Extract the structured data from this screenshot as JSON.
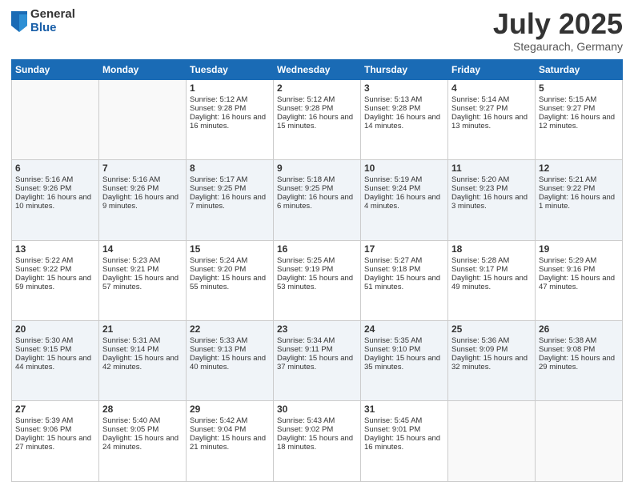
{
  "logo": {
    "general": "General",
    "blue": "Blue"
  },
  "title": {
    "month": "July 2025",
    "location": "Stegaurach, Germany"
  },
  "weekdays": [
    "Sunday",
    "Monday",
    "Tuesday",
    "Wednesday",
    "Thursday",
    "Friday",
    "Saturday"
  ],
  "weeks": [
    [
      {
        "num": "",
        "text": ""
      },
      {
        "num": "",
        "text": ""
      },
      {
        "num": "1",
        "text": "Sunrise: 5:12 AM\nSunset: 9:28 PM\nDaylight: 16 hours and 16 minutes."
      },
      {
        "num": "2",
        "text": "Sunrise: 5:12 AM\nSunset: 9:28 PM\nDaylight: 16 hours and 15 minutes."
      },
      {
        "num": "3",
        "text": "Sunrise: 5:13 AM\nSunset: 9:28 PM\nDaylight: 16 hours and 14 minutes."
      },
      {
        "num": "4",
        "text": "Sunrise: 5:14 AM\nSunset: 9:27 PM\nDaylight: 16 hours and 13 minutes."
      },
      {
        "num": "5",
        "text": "Sunrise: 5:15 AM\nSunset: 9:27 PM\nDaylight: 16 hours and 12 minutes."
      }
    ],
    [
      {
        "num": "6",
        "text": "Sunrise: 5:16 AM\nSunset: 9:26 PM\nDaylight: 16 hours and 10 minutes."
      },
      {
        "num": "7",
        "text": "Sunrise: 5:16 AM\nSunset: 9:26 PM\nDaylight: 16 hours and 9 minutes."
      },
      {
        "num": "8",
        "text": "Sunrise: 5:17 AM\nSunset: 9:25 PM\nDaylight: 16 hours and 7 minutes."
      },
      {
        "num": "9",
        "text": "Sunrise: 5:18 AM\nSunset: 9:25 PM\nDaylight: 16 hours and 6 minutes."
      },
      {
        "num": "10",
        "text": "Sunrise: 5:19 AM\nSunset: 9:24 PM\nDaylight: 16 hours and 4 minutes."
      },
      {
        "num": "11",
        "text": "Sunrise: 5:20 AM\nSunset: 9:23 PM\nDaylight: 16 hours and 3 minutes."
      },
      {
        "num": "12",
        "text": "Sunrise: 5:21 AM\nSunset: 9:22 PM\nDaylight: 16 hours and 1 minute."
      }
    ],
    [
      {
        "num": "13",
        "text": "Sunrise: 5:22 AM\nSunset: 9:22 PM\nDaylight: 15 hours and 59 minutes."
      },
      {
        "num": "14",
        "text": "Sunrise: 5:23 AM\nSunset: 9:21 PM\nDaylight: 15 hours and 57 minutes."
      },
      {
        "num": "15",
        "text": "Sunrise: 5:24 AM\nSunset: 9:20 PM\nDaylight: 15 hours and 55 minutes."
      },
      {
        "num": "16",
        "text": "Sunrise: 5:25 AM\nSunset: 9:19 PM\nDaylight: 15 hours and 53 minutes."
      },
      {
        "num": "17",
        "text": "Sunrise: 5:27 AM\nSunset: 9:18 PM\nDaylight: 15 hours and 51 minutes."
      },
      {
        "num": "18",
        "text": "Sunrise: 5:28 AM\nSunset: 9:17 PM\nDaylight: 15 hours and 49 minutes."
      },
      {
        "num": "19",
        "text": "Sunrise: 5:29 AM\nSunset: 9:16 PM\nDaylight: 15 hours and 47 minutes."
      }
    ],
    [
      {
        "num": "20",
        "text": "Sunrise: 5:30 AM\nSunset: 9:15 PM\nDaylight: 15 hours and 44 minutes."
      },
      {
        "num": "21",
        "text": "Sunrise: 5:31 AM\nSunset: 9:14 PM\nDaylight: 15 hours and 42 minutes."
      },
      {
        "num": "22",
        "text": "Sunrise: 5:33 AM\nSunset: 9:13 PM\nDaylight: 15 hours and 40 minutes."
      },
      {
        "num": "23",
        "text": "Sunrise: 5:34 AM\nSunset: 9:11 PM\nDaylight: 15 hours and 37 minutes."
      },
      {
        "num": "24",
        "text": "Sunrise: 5:35 AM\nSunset: 9:10 PM\nDaylight: 15 hours and 35 minutes."
      },
      {
        "num": "25",
        "text": "Sunrise: 5:36 AM\nSunset: 9:09 PM\nDaylight: 15 hours and 32 minutes."
      },
      {
        "num": "26",
        "text": "Sunrise: 5:38 AM\nSunset: 9:08 PM\nDaylight: 15 hours and 29 minutes."
      }
    ],
    [
      {
        "num": "27",
        "text": "Sunrise: 5:39 AM\nSunset: 9:06 PM\nDaylight: 15 hours and 27 minutes."
      },
      {
        "num": "28",
        "text": "Sunrise: 5:40 AM\nSunset: 9:05 PM\nDaylight: 15 hours and 24 minutes."
      },
      {
        "num": "29",
        "text": "Sunrise: 5:42 AM\nSunset: 9:04 PM\nDaylight: 15 hours and 21 minutes."
      },
      {
        "num": "30",
        "text": "Sunrise: 5:43 AM\nSunset: 9:02 PM\nDaylight: 15 hours and 18 minutes."
      },
      {
        "num": "31",
        "text": "Sunrise: 5:45 AM\nSunset: 9:01 PM\nDaylight: 15 hours and 16 minutes."
      },
      {
        "num": "",
        "text": ""
      },
      {
        "num": "",
        "text": ""
      }
    ]
  ]
}
